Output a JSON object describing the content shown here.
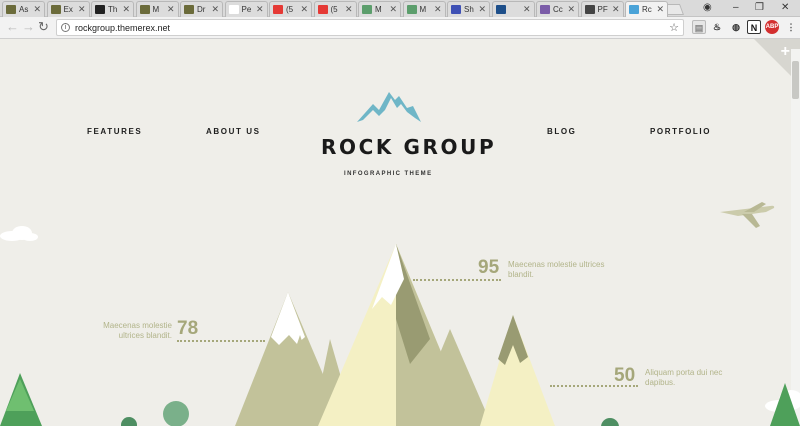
{
  "browser": {
    "tabs": [
      {
        "label": "As",
        "favicon": "#6b6b3a"
      },
      {
        "label": "Ex",
        "favicon": "#6b6b3a"
      },
      {
        "label": "Th",
        "favicon": "#222222"
      },
      {
        "label": "M",
        "favicon": "#6b6b3a"
      },
      {
        "label": "Dr",
        "favicon": "#6b6b3a"
      },
      {
        "label": "Pe",
        "favicon": "#ffffff"
      },
      {
        "label": "(5",
        "favicon": "#e53935"
      },
      {
        "label": "(5",
        "favicon": "#e53935"
      },
      {
        "label": "M",
        "favicon": "#5c9e6c"
      },
      {
        "label": "M",
        "favicon": "#5c9e6c"
      },
      {
        "label": "Sh",
        "favicon": "#3f51b5"
      },
      {
        "label": "",
        "favicon": "#1e4f8a"
      },
      {
        "label": "Cc",
        "favicon": "#7b5ca8"
      },
      {
        "label": "PF",
        "favicon": "#444444"
      },
      {
        "label": "Rc",
        "favicon": "#4aa3d8"
      }
    ],
    "url": "rockgroup.themerex.net"
  },
  "site": {
    "title": "ROCK GROUP",
    "tagline": "INFOGRAPHIC THEME",
    "nav": {
      "features": "FEATURES",
      "about": "ABOUT US",
      "blog": "BLOG",
      "portfolio": "PORTFOLIO"
    },
    "stats": [
      {
        "value": "95",
        "text": "Maecenas molestie ultrices blandit."
      },
      {
        "value": "78",
        "text": "Maecenas molestie ultrices blandit."
      },
      {
        "value": "50",
        "text": "Aliquam porta dui nec dapibus."
      }
    ]
  },
  "colors": {
    "background": "#efeee9",
    "mountain_olive": "#c2c29a",
    "mountain_dark": "#999b72",
    "mountain_cream": "#f4f0c4",
    "accent_text": "#a5a77a",
    "logo_blue": "#6fb6c7",
    "tree_green": "#4ea05a"
  }
}
